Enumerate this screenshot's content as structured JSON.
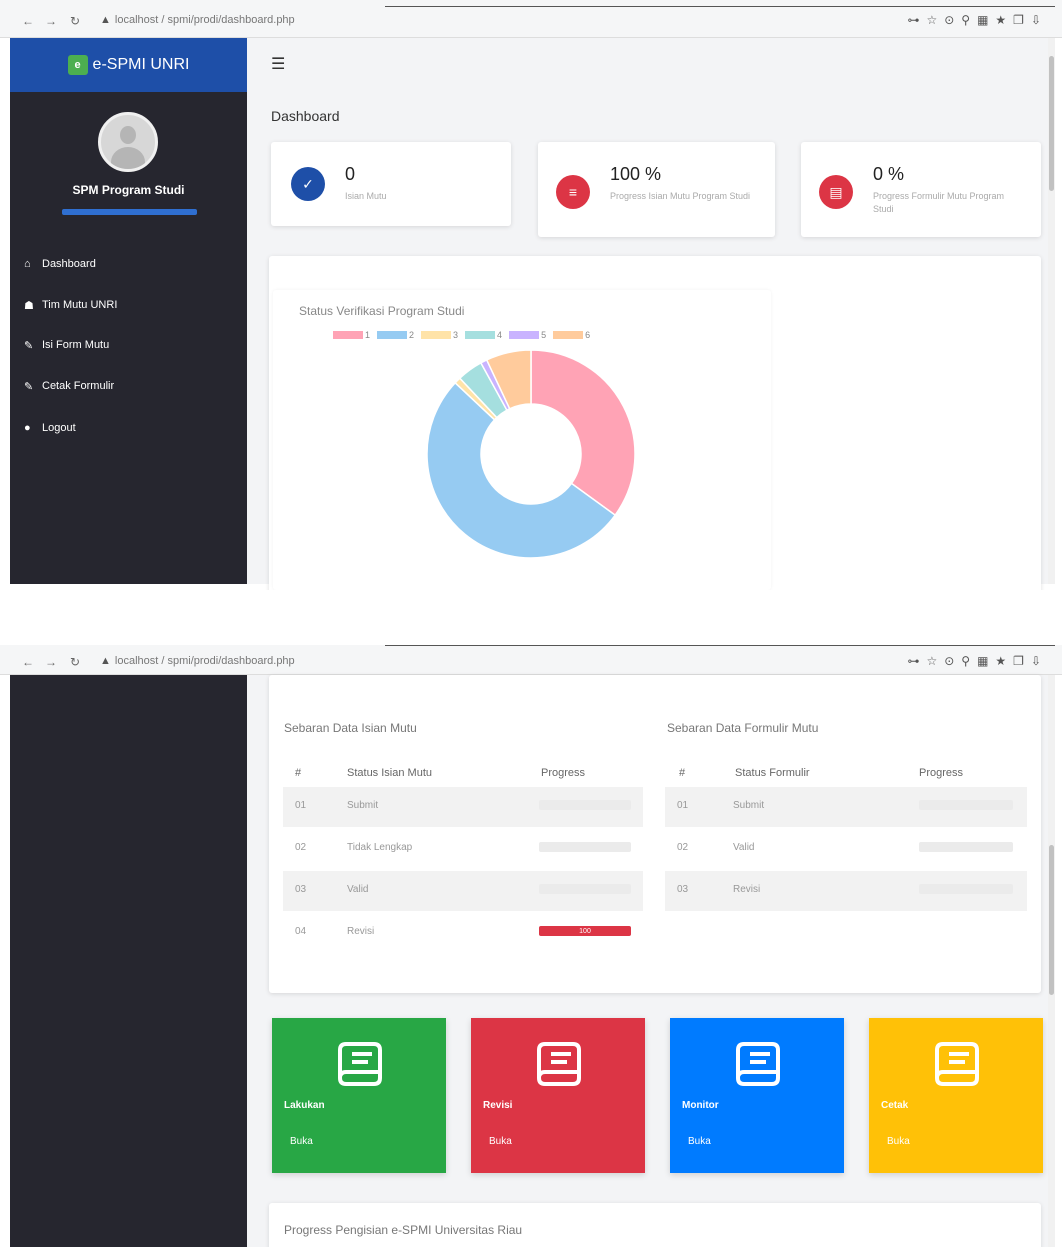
{
  "browser": {
    "url": "localhost / spmi/prodi/dashboard.php",
    "url_scrolled": "localhost / spmi/prodi/dashboard.php"
  },
  "brand": {
    "logo": "e",
    "name": "e-SPMI UNRI"
  },
  "profile": {
    "name": "SPM Program Studi"
  },
  "sidebar": {
    "items": [
      {
        "label": "Dashboard",
        "icon": "home-icon"
      },
      {
        "label": "Tim Mutu UNRI",
        "icon": "users-icon"
      },
      {
        "label": "Isi Form Mutu",
        "icon": "edit-icon"
      },
      {
        "label": "Cetak Formulir",
        "icon": "print-icon"
      },
      {
        "label": "Logout",
        "icon": "power-icon"
      }
    ]
  },
  "header": {
    "menu_icon": "hamburger-icon",
    "page_title": "Dashboard"
  },
  "stats": [
    {
      "value": "0",
      "label": "Isian Mutu",
      "color": "#1e4fa8",
      "icon": "check-icon"
    },
    {
      "value": "100 %",
      "label": "Progress Isian Mutu Program Studi",
      "color": "#dc3545",
      "icon": "list-icon"
    },
    {
      "value": "0 %",
      "label": "Progress Formulir Mutu Program Studi",
      "color": "#dc3545",
      "icon": "form-icon"
    }
  ],
  "chart_data": {
    "type": "pie",
    "title": "Status Verifikasi Program Studi",
    "legend_position": "top",
    "categories": [
      "1",
      "2",
      "3",
      "4",
      "5",
      "6"
    ],
    "values": [
      35,
      52,
      1,
      4,
      1,
      7
    ],
    "colors": [
      "#ffa3b5",
      "#96cbf2",
      "#ffe3a8",
      "#a5dfdf",
      "#c9b3ff",
      "#ffcb9c"
    ]
  },
  "table_isian": {
    "title": "Sebaran Data Isian Mutu",
    "headers": [
      "#",
      "Status Isian Mutu",
      "Progress"
    ],
    "rows": [
      {
        "no": "01",
        "status": "Submit",
        "progress": 0
      },
      {
        "no": "02",
        "status": "Tidak Lengkap",
        "progress": 0
      },
      {
        "no": "03",
        "status": "Valid",
        "progress": 0
      },
      {
        "no": "04",
        "status": "Revisi",
        "progress": 100,
        "progress_label": "100"
      }
    ]
  },
  "table_formulir": {
    "title": "Sebaran Data Formulir Mutu",
    "headers": [
      "#",
      "Status Formulir",
      "Progress"
    ],
    "rows": [
      {
        "no": "01",
        "status": "Submit",
        "progress": 0
      },
      {
        "no": "02",
        "status": "Valid",
        "progress": 0
      },
      {
        "no": "03",
        "status": "Revisi",
        "progress": 0
      }
    ]
  },
  "tiles": [
    {
      "label": "Lakukan",
      "link": "Buka",
      "color": "#28a745",
      "icon": "book-icon"
    },
    {
      "label": "Revisi",
      "link": "Buka",
      "color": "#dc3545",
      "icon": "book-icon"
    },
    {
      "label": "Monitor",
      "link": "Buka",
      "color": "#007bff",
      "icon": "book-icon"
    },
    {
      "label": "Cetak",
      "link": "Buka",
      "color": "#ffc107",
      "icon": "book-icon"
    }
  ],
  "bottom_section": {
    "title": "Progress Pengisian e-SPMI Universitas Riau"
  }
}
